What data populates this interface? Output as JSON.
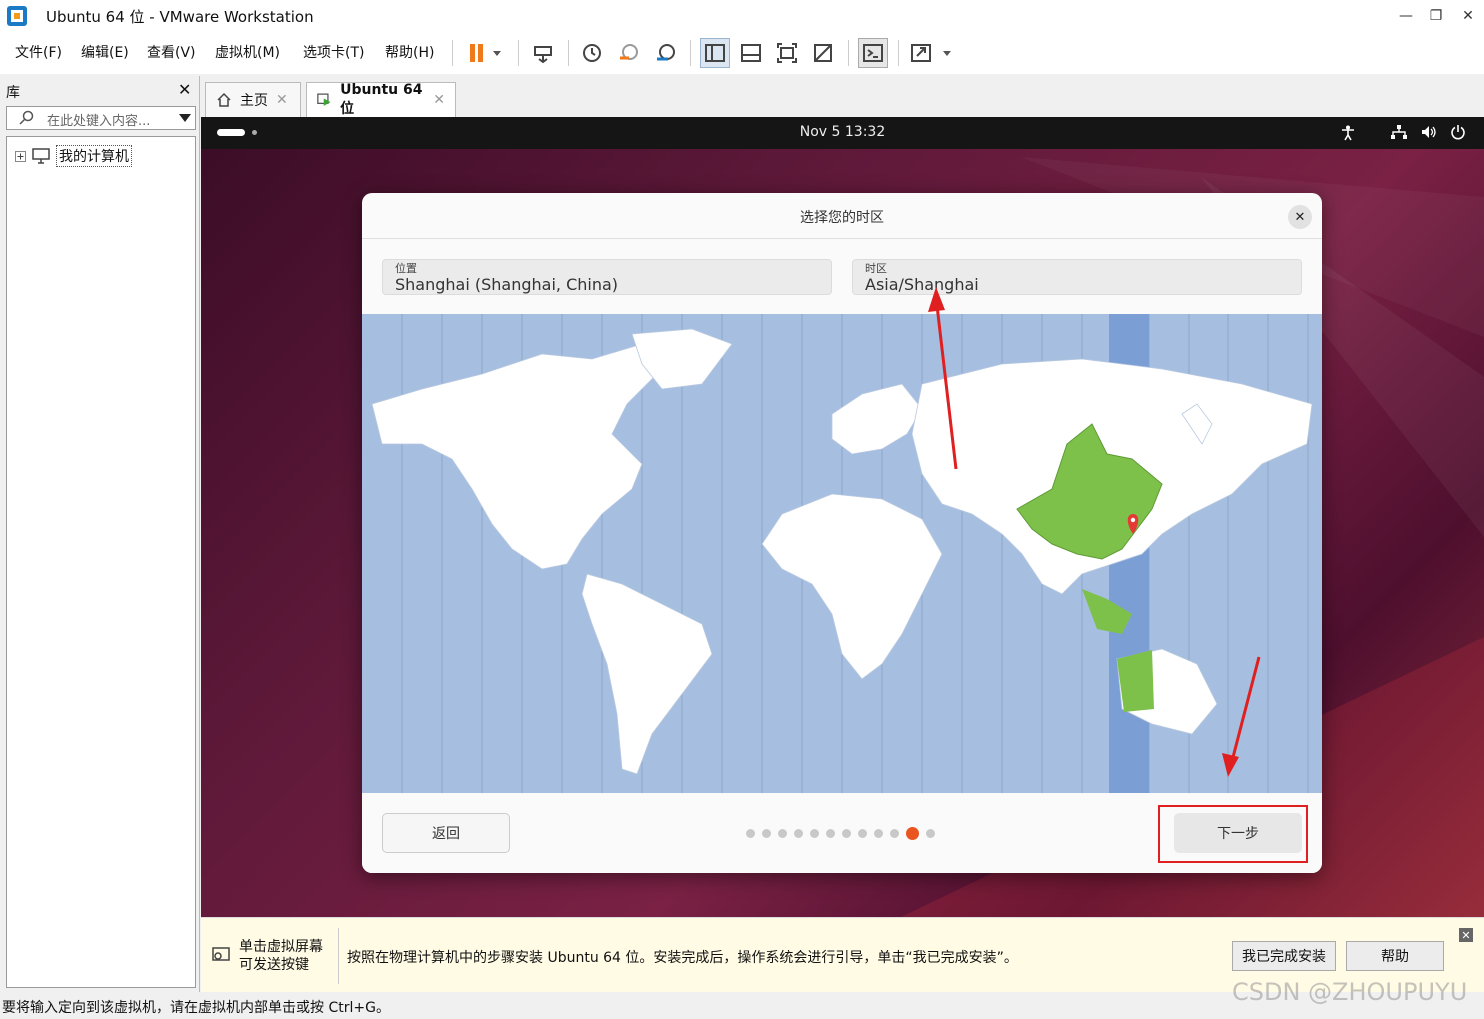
{
  "window": {
    "title": "Ubuntu 64 位 - VMware Workstation"
  },
  "menu": {
    "items": [
      "文件(F)",
      "编辑(E)",
      "查看(V)",
      "虚拟机(M)",
      "选项卡(T)",
      "帮助(H)"
    ]
  },
  "library": {
    "title": "库",
    "search_placeholder": "在此处键入内容...",
    "tree_item": "我的计算机"
  },
  "tabs": [
    {
      "label": "主页",
      "icon": "home-icon"
    },
    {
      "label": "Ubuntu 64 位",
      "icon": "vm-running-icon"
    }
  ],
  "guest": {
    "clock": "Nov 5  13:32",
    "dialog": {
      "title": "选择您的时区",
      "location_label": "位置",
      "location_value": "Shanghai (Shanghai, China)",
      "timezone_label": "时区",
      "timezone_value": "Asia/Shanghai",
      "back_label": "返回",
      "next_label": "下一步",
      "step_total": 12,
      "step_current": 11
    }
  },
  "infobar": {
    "hint": "单击虚拟屏幕\n可发送按键",
    "message": "按照在物理计算机中的步骤安装 Ubuntu 64 位。安装完成后，操作系统会进行引导，单击“我已完成安装”。",
    "done_label": "我已完成安装",
    "help_label": "帮助"
  },
  "statusbar": {
    "text": "要将输入定向到该虚拟机，请在虚拟机内部单击或按 Ctrl+G。"
  },
  "watermark": "CSDN @ZHOUPUYU",
  "colors": {
    "accent": "#e95420",
    "highlight_box": "#e02020",
    "map_ocean": "#a6bfe0",
    "map_selected_zone": "#7b9fd4",
    "map_selected_country": "#7dc14b"
  }
}
